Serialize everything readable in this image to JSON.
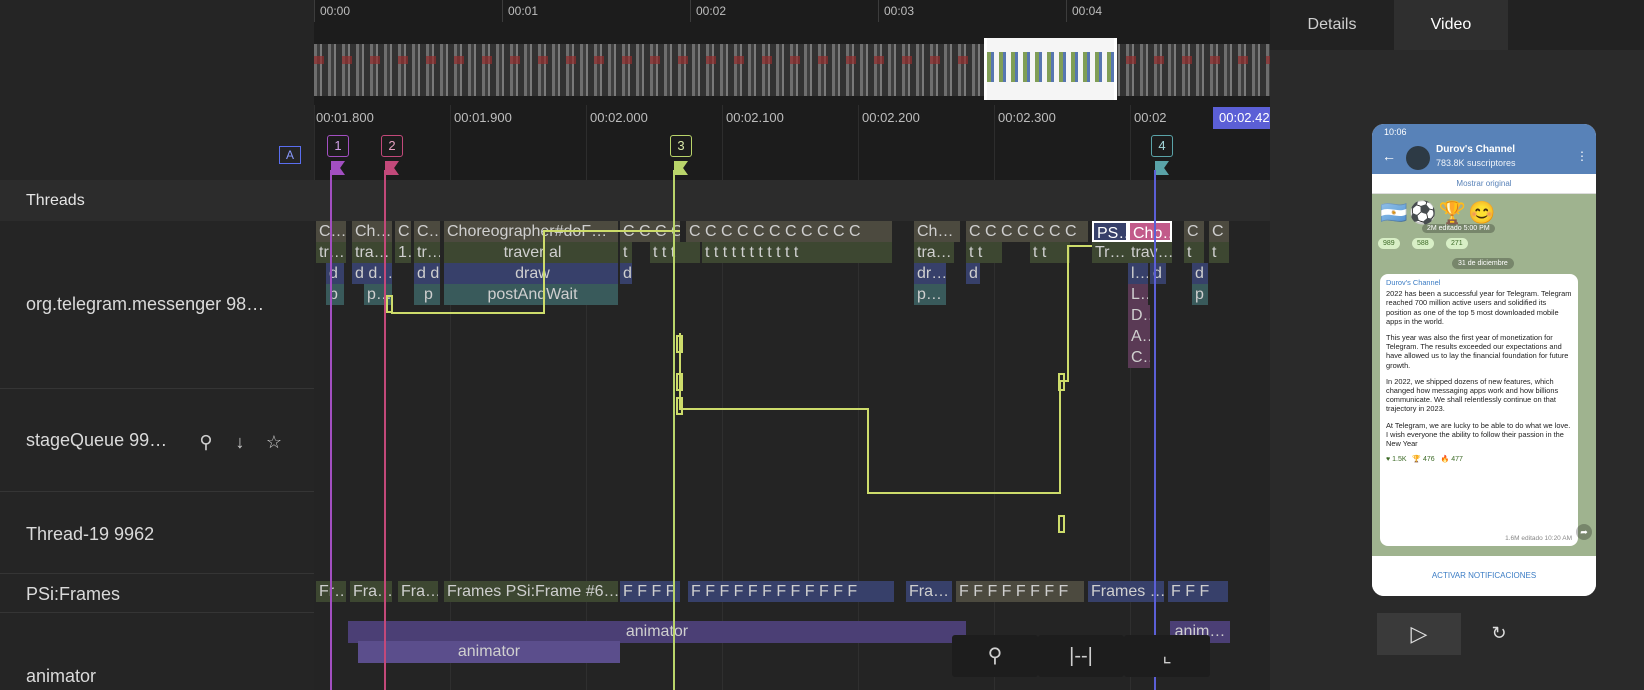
{
  "overview": {
    "labels": [
      "00:00",
      "00:01",
      "00:02",
      "00:03",
      "00:04"
    ]
  },
  "ruler": {
    "labels": [
      "00:01.800",
      "00:01.900",
      "00:02.000",
      "00:02.100",
      "00:02.200",
      "00:02.300",
      "00:02"
    ],
    "highlight": "00:02.42",
    "annotate_label": "A",
    "flags": [
      "1",
      "2",
      "3",
      "4"
    ]
  },
  "threads_header": "Threads",
  "rows": {
    "telegram": "org.telegram.messenger 98…",
    "stage_queue": "stageQueue 99…",
    "thread19": "Thread-19 9962",
    "psi_frames": "PSi:Frames",
    "animator": "animator"
  },
  "slices": {
    "s0": "C…",
    "s1": "Ch…",
    "s2": "C",
    "s3": "C…",
    "s4": "Choreographer#doF…",
    "s5": "C C C C",
    "s6": "C C C C C C C C C C C",
    "s7": "Ch…",
    "s8": "C C C C C C C",
    "s9": "PS…",
    "s10": "Cho…",
    "s11": "C",
    "s12": "C",
    "t0": "tr…",
    "t1": "tra…",
    "t2": "1…",
    "t3": "tr…",
    "t4": "traver al",
    "t5": "t",
    "t6": "t t t",
    "t7": "t t t t t t t t t t t",
    "t8": "tra…",
    "t9": "t t",
    "t10": "t t",
    "t11": "Tr…",
    "t12": "trav…",
    "t13": "t",
    "t14": "t",
    "d0": "d",
    "d1": "d d…",
    "d2": "d d",
    "d3": "draw",
    "d4": "d",
    "d5": "dr…",
    "d6": "d",
    "d7": "l…",
    "d8": "d",
    "d9": "d",
    "p0": "p",
    "p1": "p…",
    "p2": "p",
    "p3": "postAndWait",
    "p4": "p…",
    "p5": "L…",
    "p6": "p",
    "e0": "D…",
    "e1": "A…",
    "e2": "C…",
    "f0": "Fr…",
    "f1": "Fra…",
    "f2": "Fra…",
    "f3": "Frames PSi:Frame #6…",
    "f4": "F F F F",
    "f5": "F F F F F F F F F F F F",
    "f6": "Fra…",
    "f7": "F F F F F F F F",
    "f8": "Frames …",
    "f9": "F F F",
    "a0": "animator",
    "a1": "animator",
    "a2": "anim…"
  },
  "right_panel": {
    "tabs": [
      "Details",
      "Video"
    ],
    "active_tab": "Video",
    "phone": {
      "time": "10:06",
      "channel": "Durov's Channel",
      "subscribers": "783.8K suscriptores",
      "translate": "Mostrar original",
      "views_top": "2M editado 5:00 PM",
      "reactions_top": [
        "989",
        "588",
        "271"
      ],
      "date": "31 de diciembre",
      "bubble_channel": "Durov's Channel",
      "p1": "2022 has been a successful year for Telegram. Telegram reached 700 million active users and solidified its position as one of the top 5 most downloaded mobile apps in the world.",
      "p2": "This year was also the first year of monetization for Telegram. The results exceeded our expectations and have allowed us to lay the financial foundation for future growth.",
      "p3": "In 2022, we shipped dozens of new features, which changed how messaging apps work and how billions communicate. We shall relentlessly continue on that trajectory in 2023.",
      "p4": "At Telegram, we are lucky to be able to do what we love. I wish everyone the ability to follow their passion in the New Year",
      "reactions_bottom": [
        "1.5K",
        "476",
        "477"
      ],
      "meta": "1.6M editado 10:20 AM",
      "bottom": "ACTIVAR NOTIFICACIONES"
    }
  },
  "colors": {
    "flag1": "#a24fc1",
    "flag2": "#c2497a",
    "flag3": "#b9d46a",
    "flag4": "#5aa3a8",
    "selection": "#cddc6b",
    "ruler_highlight": "#5b5fd6"
  }
}
